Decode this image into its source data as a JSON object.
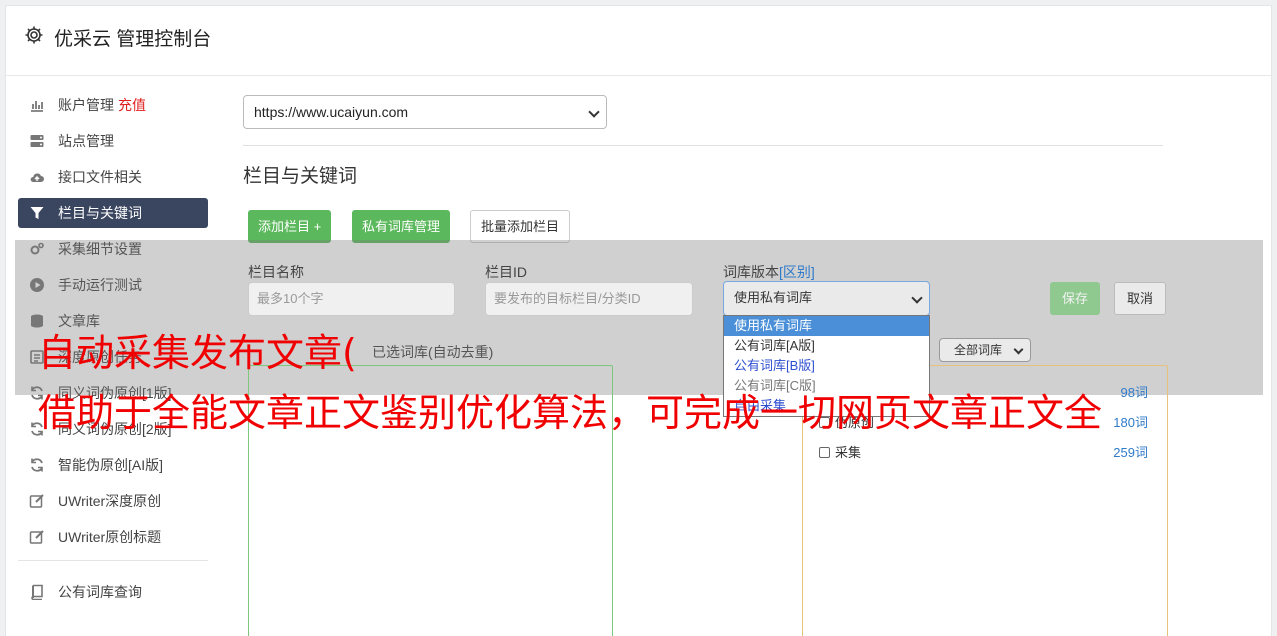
{
  "header": {
    "title": "优采云 管理控制台"
  },
  "sidebar": {
    "items": [
      {
        "label": "账户管理",
        "badge": "充值",
        "icon": "bar-chart-icon"
      },
      {
        "label": "站点管理",
        "icon": "server-icon"
      },
      {
        "label": "接口文件相关",
        "icon": "cloud-upload-icon"
      },
      {
        "label": "栏目与关键词",
        "icon": "filter-icon",
        "active": true
      },
      {
        "label": "采集细节设置",
        "icon": "cogs-icon"
      },
      {
        "label": "手动运行测试",
        "icon": "play-circle-icon"
      },
      {
        "label": "文章库",
        "icon": "database-icon"
      },
      {
        "label": "深度原创任务",
        "icon": "tasks-icon"
      },
      {
        "label": "同义词伪原创[1版]",
        "icon": "refresh-icon"
      },
      {
        "label": "同义词伪原创[2版]",
        "icon": "refresh-icon"
      },
      {
        "label": "智能伪原创[AI版]",
        "icon": "refresh-icon"
      },
      {
        "label": "UWriter深度原创",
        "icon": "edit-icon"
      },
      {
        "label": "UWriter原创标题",
        "icon": "edit-icon"
      }
    ],
    "bottom_items": [
      {
        "label": "公有词库查询",
        "icon": "book-icon"
      }
    ]
  },
  "main": {
    "site_select": {
      "value": "https://www.ucaiyun.com"
    },
    "section_title": "栏目与关键词",
    "buttons": {
      "add_column": "添加栏目 +",
      "private_lib": "私有词库管理",
      "batch_add": "批量添加栏目"
    },
    "form": {
      "name_label": "栏目名称",
      "name_placeholder": "最多10个字",
      "id_label": "栏目ID",
      "id_placeholder": "要发布的目标栏目/分类ID",
      "version_label": "词库版本",
      "version_hint": "[区别]",
      "version_value": "使用私有词库",
      "save": "保存",
      "cancel": "取消"
    },
    "dropdown_options": [
      "使用私有词库",
      "公有词库[A版]",
      "公有词库[B版]",
      "公有词库[C版]",
      "自由采集"
    ],
    "selected_label": "已选词库(自动去重)",
    "filter_select": "全部词库",
    "libraries": [
      {
        "name": "",
        "count": "98词"
      },
      {
        "name": "伪原创",
        "count": "180词"
      },
      {
        "name": "采集",
        "count": "259词"
      }
    ]
  },
  "overlay_text": {
    "line1": "自动采集发布文章(",
    "line2": "借助于全能文章正文鉴别优化算法，可完成一切网页文章正文全"
  },
  "colors": {
    "accent": "#5cb85c",
    "active_nav": "#3a4660",
    "overlay_red": "#f00000",
    "link": "#2f7bc9"
  }
}
